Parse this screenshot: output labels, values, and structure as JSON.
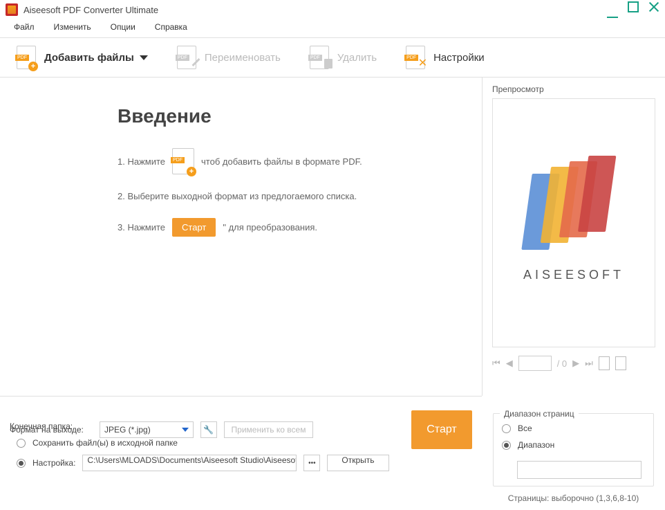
{
  "app_title": "Aiseesoft PDF Converter Ultimate",
  "menu": {
    "file": "Файл",
    "edit": "Изменить",
    "options": "Опции",
    "help": "Справка"
  },
  "toolbar": {
    "add": "Добавить файлы",
    "rename": "Переименовать",
    "delete": "Удалить",
    "settings": "Настройки"
  },
  "intro": {
    "title": "Введение",
    "step1_a": "1. Нажмите",
    "step1_b": "чтоб добавить файлы в формате PDF.",
    "step2": "2. Выберите выходной формат из предлогаемого списка.",
    "step3_a": "3. Нажмите",
    "step3_btn": "Старт",
    "step3_b": "\" для преобразования."
  },
  "preview": {
    "title": "Препросмотр",
    "brand": "AISEESOFT",
    "page_total": "/ 0"
  },
  "footer": {
    "format_label": "Формат на выходе:",
    "format_value": "JPEG (*.jpg)",
    "apply_all": "Применить ко всем",
    "dest_label": "Конечная папка:",
    "dest_same": "Сохранить файл(ы) в исходной папке",
    "dest_custom": "Настройка:",
    "dest_path": "C:\\Users\\MLOADS\\Documents\\Aiseesoft Studio\\Aiseesoft PDF",
    "dots": "•••",
    "open": "Открыть",
    "start": "Старт"
  },
  "range": {
    "legend": "Диапазон страниц",
    "all": "Все",
    "range": "Диапазон",
    "hint": "Страницы: выборочно (1,3,6,8-10)"
  }
}
